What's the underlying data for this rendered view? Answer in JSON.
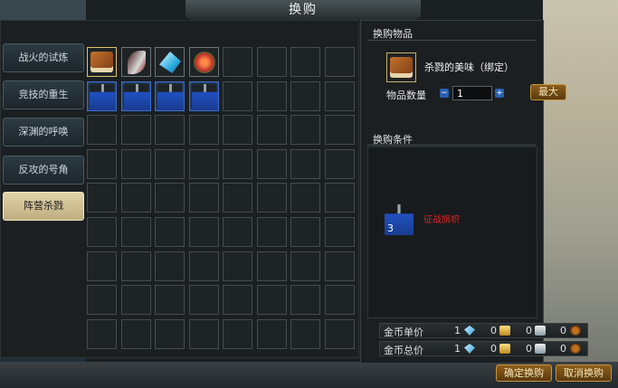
{
  "window": {
    "title": "换购"
  },
  "tabs": [
    {
      "label": "战火的试炼",
      "active": false
    },
    {
      "label": "竞技的重生",
      "active": false
    },
    {
      "label": "深渊的呼唤",
      "active": false
    },
    {
      "label": "反攻的号角",
      "active": false
    },
    {
      "label": "阵营杀戮",
      "active": true
    }
  ],
  "grid": {
    "rows": 9,
    "cols": 8,
    "items": [
      {
        "row": 0,
        "col": 0,
        "icon": "book-icon",
        "selected": true
      },
      {
        "row": 0,
        "col": 1,
        "icon": "blade-icon"
      },
      {
        "row": 0,
        "col": 2,
        "icon": "crystal-icon"
      },
      {
        "row": 0,
        "col": 3,
        "icon": "flower-icon"
      },
      {
        "row": 1,
        "col": 0,
        "icon": "banner-icon",
        "quality": "blue"
      },
      {
        "row": 1,
        "col": 1,
        "icon": "banner-icon",
        "quality": "blue"
      },
      {
        "row": 1,
        "col": 2,
        "icon": "banner-icon",
        "quality": "blue"
      },
      {
        "row": 1,
        "col": 3,
        "icon": "banner-icon",
        "quality": "blue"
      }
    ]
  },
  "exchange": {
    "section_title": "换购物品",
    "item_name": "杀戮的美味（绑定）",
    "quantity_label": "物品数量",
    "quantity_value": "1",
    "minus_symbol": "−",
    "plus_symbol": "+",
    "max_label": "最大"
  },
  "condition": {
    "section_title": "换购条件",
    "req_item_name": "征战旗帜",
    "req_count": "3"
  },
  "prices": [
    {
      "label": "金币单价",
      "diamond": "1",
      "gold": "0",
      "silver": "0",
      "coin": "0"
    },
    {
      "label": "金币总价",
      "diamond": "1",
      "gold": "0",
      "silver": "0",
      "coin": "0"
    }
  ],
  "buttons": {
    "confirm": "确定换购",
    "cancel": "取消换购"
  },
  "colors": {
    "accent_gold": "#c8963a",
    "condition_red": "#e02020",
    "active_tab": "#e0d2a8"
  }
}
